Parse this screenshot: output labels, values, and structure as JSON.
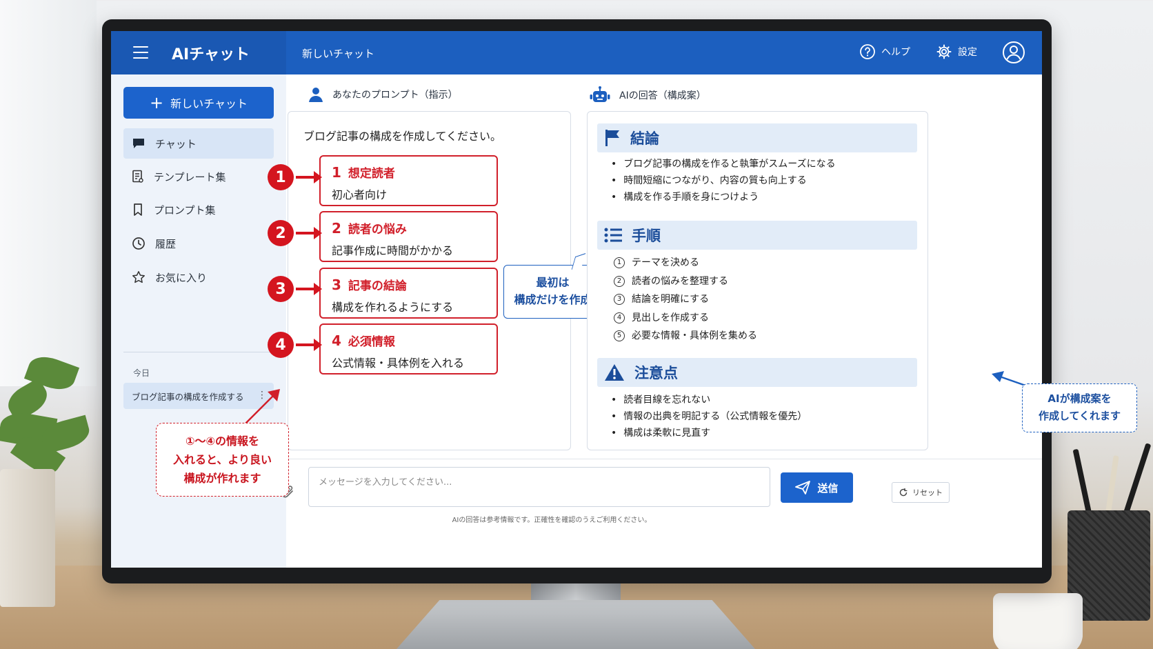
{
  "app": {
    "title": "AIチャット",
    "chat_title": "新しいチャット"
  },
  "topbar": {
    "help_label": "ヘルプ",
    "settings_label": "設定"
  },
  "sidebar": {
    "new_chat_label": "新しいチャット",
    "items": [
      {
        "label": "チャット",
        "icon": "chat-bubble-icon",
        "active": true
      },
      {
        "label": "テンプレート集",
        "icon": "template-icon",
        "active": false
      },
      {
        "label": "プロンプト集",
        "icon": "bookmark-icon",
        "active": false
      },
      {
        "label": "履歴",
        "icon": "clock-icon",
        "active": false
      },
      {
        "label": "お気に入り",
        "icon": "star-icon",
        "active": false
      }
    ],
    "today_label": "今日",
    "history_item": "ブログ記事の構成を作成する"
  },
  "prompt_panel": {
    "heading": "あなたのプロンプト（指示）",
    "text": "ブログ記事の構成を作成してください。",
    "items": [
      {
        "marker": "1",
        "num": "1",
        "title": "想定読者",
        "value": "初心者向け"
      },
      {
        "marker": "2",
        "num": "2",
        "title": "読者の悩み",
        "value": "記事作成に時間がかかる"
      },
      {
        "marker": "3",
        "num": "3",
        "title": "記事の結論",
        "value": "構成を作れるようにする"
      },
      {
        "marker": "4",
        "num": "4",
        "title": "必須情報",
        "value": "公式情報・具体例を入れる"
      }
    ]
  },
  "middle_callout": {
    "line1": "最初は",
    "line2": "構成だけを作成"
  },
  "answer_panel": {
    "heading": "AIの回答（構成案）",
    "sections": [
      {
        "title": "結論",
        "icon": "flag-icon",
        "style": "bullet",
        "items": [
          "ブログ記事の構成を作ると執筆がスムーズになる",
          "時間短縮につながり、内容の質も向上する",
          "構成を作る手順を身につけよう"
        ]
      },
      {
        "title": "手順",
        "icon": "list-icon",
        "style": "numbered",
        "items": [
          {
            "n": "1",
            "text": "テーマを決める"
          },
          {
            "n": "2",
            "text": "読者の悩みを整理する"
          },
          {
            "n": "3",
            "text": "結論を明確にする"
          },
          {
            "n": "4",
            "text": "見出しを作成する"
          },
          {
            "n": "5",
            "text": "必要な情報・具体例を集める"
          }
        ]
      },
      {
        "title": "注意点",
        "icon": "warning-icon",
        "style": "bullet",
        "items": [
          "読者目線を忘れない",
          "情報の出典を明記する（公式情報を優先）",
          "構成は柔軟に見直す"
        ]
      }
    ]
  },
  "composer": {
    "placeholder": "メッセージを入力してください...",
    "send_label": "送信",
    "reset_label": "リセット",
    "disclaimer": "AIの回答は参考情報です。正確性を確認のうえご利用ください。"
  },
  "annotations": {
    "left_callout": [
      "①〜④の情報を",
      "入れると、より良い",
      "構成が作れます"
    ],
    "right_callout": [
      "AIが構成案を",
      "作成してくれます"
    ]
  },
  "colors": {
    "primary": "#1c5fbf",
    "accent_red": "#d11f2a",
    "section_bg": "#e2ecf8",
    "sidebar_bg": "#eef3fa"
  }
}
